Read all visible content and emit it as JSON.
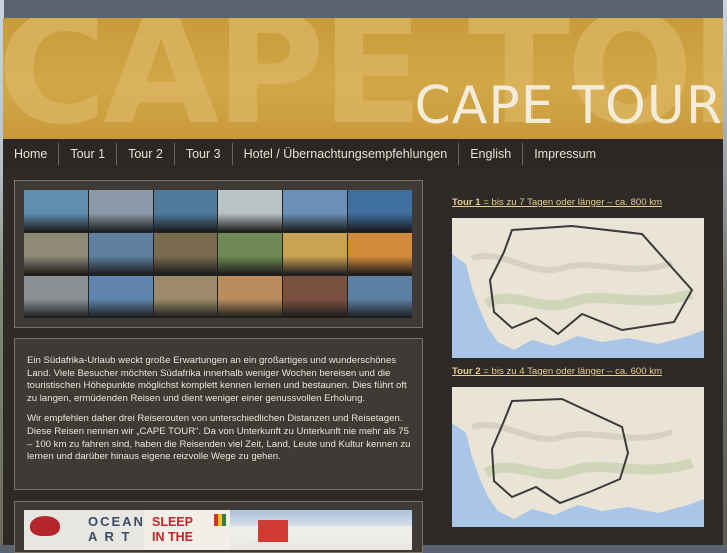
{
  "header": {
    "background_word": "CAPE TOI",
    "title": "CAPE TOUR"
  },
  "nav": {
    "items": [
      {
        "label": "Home"
      },
      {
        "label": "Tour 1"
      },
      {
        "label": "Tour 2"
      },
      {
        "label": "Tour 3"
      },
      {
        "label": "Hotel / Übernachtungsempfehlungen"
      },
      {
        "label": "English"
      },
      {
        "label": "Impressum"
      }
    ]
  },
  "intro": {
    "paragraph1": "Ein Südafrika-Urlaub weckt große Erwartungen an ein großartiges und wunderschönes Land. Viele Besucher möchten Südafrika innerhalb weniger Wochen bereisen und die touristischen Höhepunkte möglichst komplett kennen lernen und bestaunen. Dies führt oft zu langen, ermüdenden Reisen und dient weniger einer genussvollen Erholung.",
    "paragraph2": "Wir empfehlen daher drei Reiserouten von unterschiedlichen Distanzen und Reisetagen. Diese Reisen nennen wir „CAPE TOUR“. Da von Unterkunft zu Unterkunft nie mehr als 75 – 100 km zu fahren sind, haben die Reisenden viel Zeit, Land, Leute und Kultur kennen zu lernen und darüber hinaus eigene reizvolle Wege zu gehen."
  },
  "ads": {
    "ocean_line1": "OCEAN",
    "ocean_line2": "A R T",
    "sleep_line1": "SLEEP",
    "sleep_line2": "IN THE"
  },
  "tours": [
    {
      "name": "Tour 1",
      "desc": " = bis zu 7 Tagen oder länger – ca. 800 km"
    },
    {
      "name": "Tour 2",
      "desc": " = bis zu 4 Tagen oder länger – ca. 600 km"
    }
  ],
  "mosaic_colors": [
    [
      "#5f8fae",
      "#8a9aa8",
      "#4f7a9b",
      "#b9c2c4",
      "#6a8fb8",
      "#3f6f9e"
    ],
    [
      "#8e8a76",
      "#5f7f9c",
      "#7a6a4e",
      "#6f8a54",
      "#c9a254",
      "#d28a3a"
    ],
    [
      "#8a8f93",
      "#5f84ad",
      "#9c8a6a",
      "#b88e5c",
      "#7a5040",
      "#5d7fa3"
    ]
  ],
  "colors": {
    "header_gold": "#c89a3a",
    "page_bg": "#2d2a27",
    "link": "#e7cf8c"
  }
}
